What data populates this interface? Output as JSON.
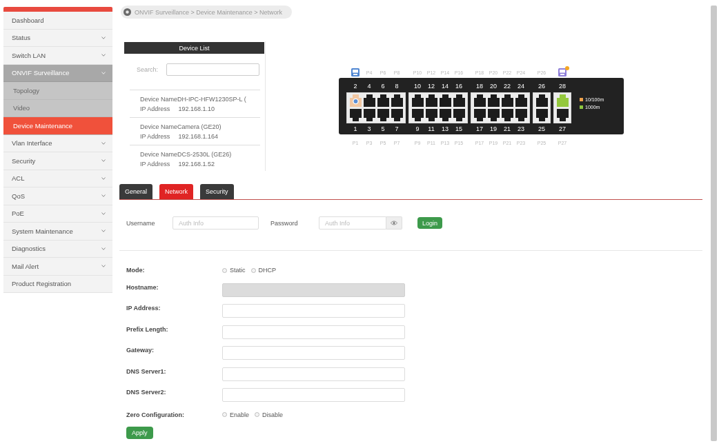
{
  "sidebar": {
    "items": [
      {
        "label": "Dashboard",
        "kind": "link",
        "expanded": false,
        "selected": false
      },
      {
        "label": "Status",
        "kind": "group",
        "expanded": false,
        "selected": false
      },
      {
        "label": "Switch LAN",
        "kind": "group",
        "expanded": false,
        "selected": false
      },
      {
        "label": "ONVIF Surveillance",
        "kind": "group",
        "expanded": true,
        "selected": false,
        "children": [
          {
            "label": "Topology",
            "selected": false
          },
          {
            "label": "Video",
            "selected": false
          },
          {
            "label": "Device Maintenance",
            "selected": true
          }
        ]
      },
      {
        "label": "Vlan Interface",
        "kind": "group",
        "expanded": false,
        "selected": false
      },
      {
        "label": "Security",
        "kind": "group",
        "expanded": false,
        "selected": false
      },
      {
        "label": "ACL",
        "kind": "group",
        "expanded": false,
        "selected": false
      },
      {
        "label": "QoS",
        "kind": "group",
        "expanded": false,
        "selected": false
      },
      {
        "label": "PoE",
        "kind": "group",
        "expanded": false,
        "selected": false
      },
      {
        "label": "System Maintenance",
        "kind": "group",
        "expanded": false,
        "selected": false
      },
      {
        "label": "Diagnostics",
        "kind": "group",
        "expanded": false,
        "selected": false
      },
      {
        "label": "Mail Alert",
        "kind": "group",
        "expanded": false,
        "selected": false
      },
      {
        "label": "Product Registration",
        "kind": "link",
        "expanded": false,
        "selected": false
      }
    ]
  },
  "breadcrumb": {
    "text": "ONVIF Surveillance > Device Maintenance > Network"
  },
  "device_list": {
    "title": "Device List",
    "search": {
      "label": "Search:"
    },
    "devices": [
      {
        "name": "Device NameDH-IPC-HFW1230SP-L (",
        "ip_label": "IP Address",
        "ip": "192.168.1.10"
      },
      {
        "name": "Device NameCamera (GE20)",
        "ip_label": "IP Address",
        "ip": "192.168.1.164"
      },
      {
        "name": "Device NameDCS-2530L (GE26)",
        "ip_label": "IP Address",
        "ip": "192.168.1.52"
      }
    ]
  },
  "switch_panel": {
    "port_groups": [
      {
        "columns": [
          {
            "marker": {
              "kind": "device",
              "color": "#4f86d2",
              "badge": false
            },
            "top": {
              "number": "2",
              "kind": "fast",
              "device": true
            },
            "bottom": {
              "number": "1",
              "kind": "idle",
              "device": false
            },
            "label": "P1"
          },
          {
            "marker": {
              "kind": "label",
              "text": "P4"
            },
            "top": {
              "number": "4",
              "kind": "idle",
              "device": false
            },
            "bottom": {
              "number": "3",
              "kind": "idle",
              "device": false
            },
            "label": "P3"
          },
          {
            "marker": {
              "kind": "label",
              "text": "P6"
            },
            "top": {
              "number": "6",
              "kind": "idle",
              "device": false
            },
            "bottom": {
              "number": "5",
              "kind": "idle",
              "device": false
            },
            "label": "P5"
          },
          {
            "marker": {
              "kind": "label",
              "text": "P8"
            },
            "top": {
              "number": "8",
              "kind": "idle",
              "device": false
            },
            "bottom": {
              "number": "7",
              "kind": "idle",
              "device": false
            },
            "label": "P7"
          }
        ]
      },
      {
        "columns": [
          {
            "marker": {
              "kind": "label",
              "text": "P10"
            },
            "top": {
              "number": "10",
              "kind": "idle",
              "device": false
            },
            "bottom": {
              "number": "9",
              "kind": "idle",
              "device": false
            },
            "label": "P9"
          },
          {
            "marker": {
              "kind": "label",
              "text": "P12"
            },
            "top": {
              "number": "12",
              "kind": "idle",
              "device": false
            },
            "bottom": {
              "number": "11",
              "kind": "idle",
              "device": false
            },
            "label": "P11"
          },
          {
            "marker": {
              "kind": "label",
              "text": "P14"
            },
            "top": {
              "number": "14",
              "kind": "idle",
              "device": false
            },
            "bottom": {
              "number": "13",
              "kind": "idle",
              "device": false
            },
            "label": "P13"
          },
          {
            "marker": {
              "kind": "label",
              "text": "P16"
            },
            "top": {
              "number": "16",
              "kind": "idle",
              "device": false
            },
            "bottom": {
              "number": "15",
              "kind": "idle",
              "device": false
            },
            "label": "P15"
          }
        ]
      },
      {
        "columns": [
          {
            "marker": {
              "kind": "label",
              "text": "P18"
            },
            "top": {
              "number": "18",
              "kind": "idle",
              "device": false
            },
            "bottom": {
              "number": "17",
              "kind": "idle",
              "device": false
            },
            "label": "P17"
          },
          {
            "marker": {
              "kind": "label",
              "text": "P20"
            },
            "top": {
              "number": "20",
              "kind": "idle",
              "device": false
            },
            "bottom": {
              "number": "19",
              "kind": "idle",
              "device": false
            },
            "label": "P19"
          },
          {
            "marker": {
              "kind": "label",
              "text": "P22"
            },
            "top": {
              "number": "22",
              "kind": "idle",
              "device": false
            },
            "bottom": {
              "number": "21",
              "kind": "idle",
              "device": false
            },
            "label": "P21"
          },
          {
            "marker": {
              "kind": "label",
              "text": "P24"
            },
            "top": {
              "number": "24",
              "kind": "idle",
              "device": false
            },
            "bottom": {
              "number": "23",
              "kind": "idle",
              "device": false
            },
            "label": "P23"
          }
        ]
      },
      {
        "columns": [
          {
            "marker": {
              "kind": "label",
              "text": "P26"
            },
            "top": {
              "number": "26",
              "kind": "idle",
              "device": false
            },
            "bottom": {
              "number": "25",
              "kind": "idle",
              "device": false
            },
            "label": "P25"
          }
        ]
      },
      {
        "columns": [
          {
            "marker": {
              "kind": "device",
              "color": "#8f7fd8",
              "badge": true
            },
            "top": {
              "number": "28",
              "kind": "gigabit",
              "device": false
            },
            "bottom": {
              "number": "27",
              "kind": "idle",
              "device": false
            },
            "label": "P27"
          }
        ]
      }
    ],
    "legend": [
      {
        "label": "10/100m",
        "color": "#f0a24a"
      },
      {
        "label": "1000m",
        "color": "#8dc63f"
      }
    ]
  },
  "tabs": [
    {
      "label": "General",
      "selected": false
    },
    {
      "label": "Network",
      "selected": true
    },
    {
      "label": "Security",
      "selected": false
    }
  ],
  "login": {
    "username": {
      "label": "Username",
      "placeholder": "Auth Info"
    },
    "password": {
      "label": "Password",
      "placeholder": "Auth Info"
    },
    "button": "Login"
  },
  "form": {
    "fields": [
      {
        "kind": "radio",
        "label": "Mode:",
        "options": [
          {
            "label": "Static",
            "selected": false
          },
          {
            "label": "DHCP",
            "selected": false
          }
        ]
      },
      {
        "kind": "text",
        "label": "Hostname:",
        "disabled": true
      },
      {
        "kind": "text",
        "label": "IP Address:",
        "disabled": false
      },
      {
        "kind": "text",
        "label": "Prefix Length:",
        "disabled": false
      },
      {
        "kind": "text",
        "label": "Gateway:",
        "disabled": false
      },
      {
        "kind": "text",
        "label": "DNS Server1:",
        "disabled": false
      },
      {
        "kind": "text",
        "label": "DNS Server2:",
        "disabled": false
      },
      {
        "kind": "radio",
        "label": "Zero Configuration:",
        "options": [
          {
            "label": "Enable",
            "selected": false
          },
          {
            "label": "Disable",
            "selected": false
          }
        ]
      }
    ],
    "button": "Apply"
  }
}
